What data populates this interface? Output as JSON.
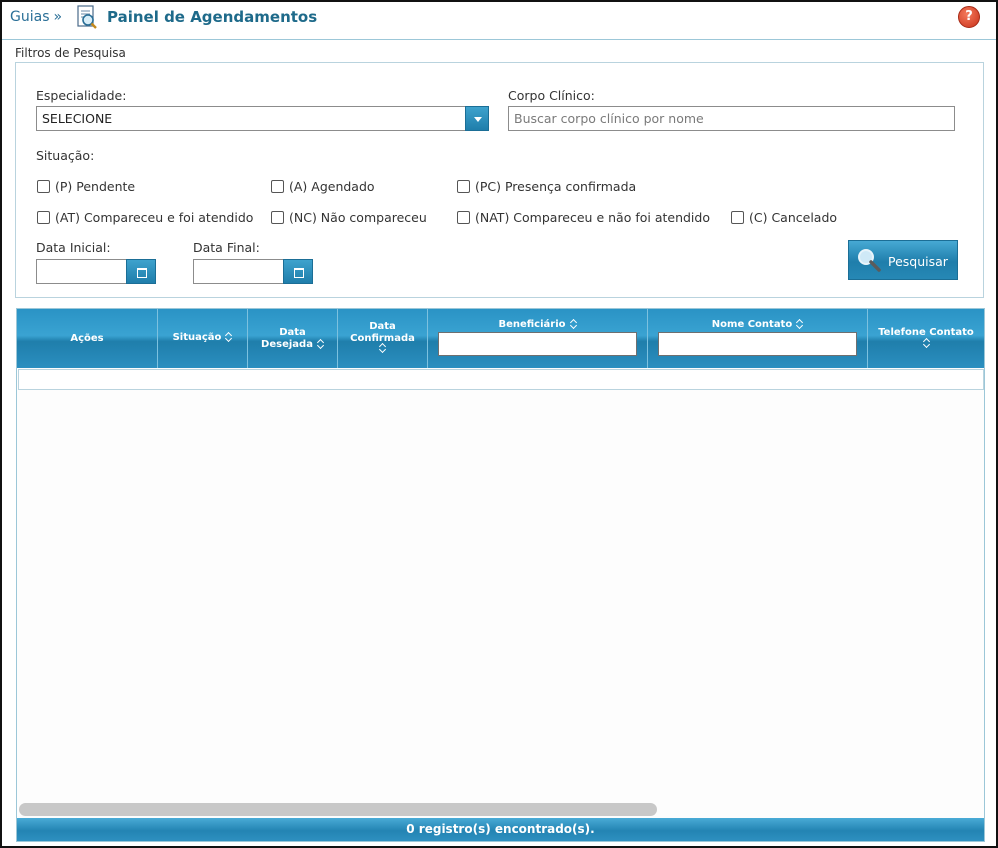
{
  "header": {
    "breadcrumb": "Guias",
    "breadcrumb_separator": "»",
    "title": "Painel de Agendamentos",
    "help_label": "?"
  },
  "filters": {
    "legend": "Filtros de Pesquisa",
    "especialidade_label": "Especialidade:",
    "especialidade_value": "SELECIONE",
    "corpo_clinico_label": "Corpo Clínico:",
    "corpo_clinico_placeholder": "Buscar corpo clínico por nome",
    "situacao_label": "Situação:",
    "situacoes": [
      "(P) Pendente",
      "(A) Agendado",
      "(PC) Presença confirmada",
      "(AT) Compareceu e foi atendido",
      "(NC) Não compareceu",
      "(NAT) Compareceu e não foi atendido",
      "(C) Cancelado"
    ],
    "data_inicial_label": "Data Inicial:",
    "data_final_label": "Data Final:",
    "search_button": "Pesquisar"
  },
  "grid": {
    "columns": {
      "acoes": "Ações",
      "situacao": "Situação",
      "data_desejada_1": "Data",
      "data_desejada_2": "Desejada",
      "data_confirmada_1": "Data",
      "data_confirmada_2": "Confirmada",
      "beneficiario": "Beneficiário",
      "nome_contato": "Nome Contato",
      "telefone_contato": "Telefone Contato"
    },
    "footer": "0 registro(s) encontrado(s)."
  },
  "colors": {
    "accent": "#1f7eab",
    "title": "#1e6a8a",
    "help": "#c9321b"
  }
}
